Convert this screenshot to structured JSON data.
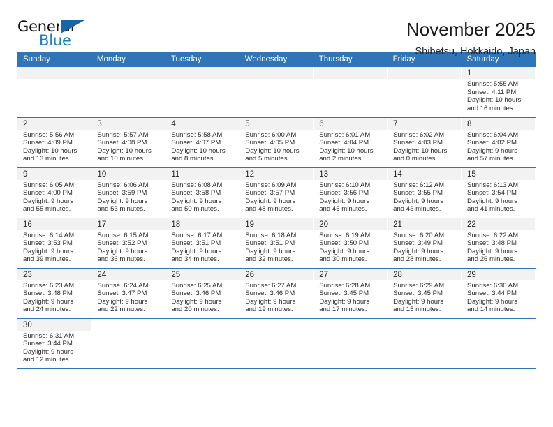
{
  "brand": {
    "name_part1": "General",
    "name_part2": "Blue",
    "accent_color": "#1b7fc4",
    "triangle_color": "#1565a8"
  },
  "header": {
    "title": "November 2025",
    "subtitle": "Shibetsu, Hokkaido, Japan",
    "header_bg_color": "#3075b8",
    "daynum_bg_color": "#f2f2f2"
  },
  "weekday_headers": [
    "Sunday",
    "Monday",
    "Tuesday",
    "Wednesday",
    "Thursday",
    "Friday",
    "Saturday"
  ],
  "weeks": [
    [
      {
        "day": "",
        "sunrise": "",
        "sunset": "",
        "daylight_line1": "",
        "daylight_line2": ""
      },
      {
        "day": "",
        "sunrise": "",
        "sunset": "",
        "daylight_line1": "",
        "daylight_line2": ""
      },
      {
        "day": "",
        "sunrise": "",
        "sunset": "",
        "daylight_line1": "",
        "daylight_line2": ""
      },
      {
        "day": "",
        "sunrise": "",
        "sunset": "",
        "daylight_line1": "",
        "daylight_line2": ""
      },
      {
        "day": "",
        "sunrise": "",
        "sunset": "",
        "daylight_line1": "",
        "daylight_line2": ""
      },
      {
        "day": "",
        "sunrise": "",
        "sunset": "",
        "daylight_line1": "",
        "daylight_line2": ""
      },
      {
        "day": "1",
        "sunrise": "Sunrise: 5:55 AM",
        "sunset": "Sunset: 4:11 PM",
        "daylight_line1": "Daylight: 10 hours",
        "daylight_line2": "and 16 minutes."
      }
    ],
    [
      {
        "day": "2",
        "sunrise": "Sunrise: 5:56 AM",
        "sunset": "Sunset: 4:09 PM",
        "daylight_line1": "Daylight: 10 hours",
        "daylight_line2": "and 13 minutes."
      },
      {
        "day": "3",
        "sunrise": "Sunrise: 5:57 AM",
        "sunset": "Sunset: 4:08 PM",
        "daylight_line1": "Daylight: 10 hours",
        "daylight_line2": "and 10 minutes."
      },
      {
        "day": "4",
        "sunrise": "Sunrise: 5:58 AM",
        "sunset": "Sunset: 4:07 PM",
        "daylight_line1": "Daylight: 10 hours",
        "daylight_line2": "and 8 minutes."
      },
      {
        "day": "5",
        "sunrise": "Sunrise: 6:00 AM",
        "sunset": "Sunset: 4:05 PM",
        "daylight_line1": "Daylight: 10 hours",
        "daylight_line2": "and 5 minutes."
      },
      {
        "day": "6",
        "sunrise": "Sunrise: 6:01 AM",
        "sunset": "Sunset: 4:04 PM",
        "daylight_line1": "Daylight: 10 hours",
        "daylight_line2": "and 2 minutes."
      },
      {
        "day": "7",
        "sunrise": "Sunrise: 6:02 AM",
        "sunset": "Sunset: 4:03 PM",
        "daylight_line1": "Daylight: 10 hours",
        "daylight_line2": "and 0 minutes."
      },
      {
        "day": "8",
        "sunrise": "Sunrise: 6:04 AM",
        "sunset": "Sunset: 4:02 PM",
        "daylight_line1": "Daylight: 9 hours",
        "daylight_line2": "and 57 minutes."
      }
    ],
    [
      {
        "day": "9",
        "sunrise": "Sunrise: 6:05 AM",
        "sunset": "Sunset: 4:00 PM",
        "daylight_line1": "Daylight: 9 hours",
        "daylight_line2": "and 55 minutes."
      },
      {
        "day": "10",
        "sunrise": "Sunrise: 6:06 AM",
        "sunset": "Sunset: 3:59 PM",
        "daylight_line1": "Daylight: 9 hours",
        "daylight_line2": "and 53 minutes."
      },
      {
        "day": "11",
        "sunrise": "Sunrise: 6:08 AM",
        "sunset": "Sunset: 3:58 PM",
        "daylight_line1": "Daylight: 9 hours",
        "daylight_line2": "and 50 minutes."
      },
      {
        "day": "12",
        "sunrise": "Sunrise: 6:09 AM",
        "sunset": "Sunset: 3:57 PM",
        "daylight_line1": "Daylight: 9 hours",
        "daylight_line2": "and 48 minutes."
      },
      {
        "day": "13",
        "sunrise": "Sunrise: 6:10 AM",
        "sunset": "Sunset: 3:56 PM",
        "daylight_line1": "Daylight: 9 hours",
        "daylight_line2": "and 45 minutes."
      },
      {
        "day": "14",
        "sunrise": "Sunrise: 6:12 AM",
        "sunset": "Sunset: 3:55 PM",
        "daylight_line1": "Daylight: 9 hours",
        "daylight_line2": "and 43 minutes."
      },
      {
        "day": "15",
        "sunrise": "Sunrise: 6:13 AM",
        "sunset": "Sunset: 3:54 PM",
        "daylight_line1": "Daylight: 9 hours",
        "daylight_line2": "and 41 minutes."
      }
    ],
    [
      {
        "day": "16",
        "sunrise": "Sunrise: 6:14 AM",
        "sunset": "Sunset: 3:53 PM",
        "daylight_line1": "Daylight: 9 hours",
        "daylight_line2": "and 39 minutes."
      },
      {
        "day": "17",
        "sunrise": "Sunrise: 6:15 AM",
        "sunset": "Sunset: 3:52 PM",
        "daylight_line1": "Daylight: 9 hours",
        "daylight_line2": "and 36 minutes."
      },
      {
        "day": "18",
        "sunrise": "Sunrise: 6:17 AM",
        "sunset": "Sunset: 3:51 PM",
        "daylight_line1": "Daylight: 9 hours",
        "daylight_line2": "and 34 minutes."
      },
      {
        "day": "19",
        "sunrise": "Sunrise: 6:18 AM",
        "sunset": "Sunset: 3:51 PM",
        "daylight_line1": "Daylight: 9 hours",
        "daylight_line2": "and 32 minutes."
      },
      {
        "day": "20",
        "sunrise": "Sunrise: 6:19 AM",
        "sunset": "Sunset: 3:50 PM",
        "daylight_line1": "Daylight: 9 hours",
        "daylight_line2": "and 30 minutes."
      },
      {
        "day": "21",
        "sunrise": "Sunrise: 6:20 AM",
        "sunset": "Sunset: 3:49 PM",
        "daylight_line1": "Daylight: 9 hours",
        "daylight_line2": "and 28 minutes."
      },
      {
        "day": "22",
        "sunrise": "Sunrise: 6:22 AM",
        "sunset": "Sunset: 3:48 PM",
        "daylight_line1": "Daylight: 9 hours",
        "daylight_line2": "and 26 minutes."
      }
    ],
    [
      {
        "day": "23",
        "sunrise": "Sunrise: 6:23 AM",
        "sunset": "Sunset: 3:48 PM",
        "daylight_line1": "Daylight: 9 hours",
        "daylight_line2": "and 24 minutes."
      },
      {
        "day": "24",
        "sunrise": "Sunrise: 6:24 AM",
        "sunset": "Sunset: 3:47 PM",
        "daylight_line1": "Daylight: 9 hours",
        "daylight_line2": "and 22 minutes."
      },
      {
        "day": "25",
        "sunrise": "Sunrise: 6:25 AM",
        "sunset": "Sunset: 3:46 PM",
        "daylight_line1": "Daylight: 9 hours",
        "daylight_line2": "and 20 minutes."
      },
      {
        "day": "26",
        "sunrise": "Sunrise: 6:27 AM",
        "sunset": "Sunset: 3:46 PM",
        "daylight_line1": "Daylight: 9 hours",
        "daylight_line2": "and 19 minutes."
      },
      {
        "day": "27",
        "sunrise": "Sunrise: 6:28 AM",
        "sunset": "Sunset: 3:45 PM",
        "daylight_line1": "Daylight: 9 hours",
        "daylight_line2": "and 17 minutes."
      },
      {
        "day": "28",
        "sunrise": "Sunrise: 6:29 AM",
        "sunset": "Sunset: 3:45 PM",
        "daylight_line1": "Daylight: 9 hours",
        "daylight_line2": "and 15 minutes."
      },
      {
        "day": "29",
        "sunrise": "Sunrise: 6:30 AM",
        "sunset": "Sunset: 3:44 PM",
        "daylight_line1": "Daylight: 9 hours",
        "daylight_line2": "and 14 minutes."
      }
    ],
    [
      {
        "day": "30",
        "sunrise": "Sunrise: 6:31 AM",
        "sunset": "Sunset: 3:44 PM",
        "daylight_line1": "Daylight: 9 hours",
        "daylight_line2": "and 12 minutes."
      },
      {
        "day": "",
        "sunrise": "",
        "sunset": "",
        "daylight_line1": "",
        "daylight_line2": ""
      },
      {
        "day": "",
        "sunrise": "",
        "sunset": "",
        "daylight_line1": "",
        "daylight_line2": ""
      },
      {
        "day": "",
        "sunrise": "",
        "sunset": "",
        "daylight_line1": "",
        "daylight_line2": ""
      },
      {
        "day": "",
        "sunrise": "",
        "sunset": "",
        "daylight_line1": "",
        "daylight_line2": ""
      },
      {
        "day": "",
        "sunrise": "",
        "sunset": "",
        "daylight_line1": "",
        "daylight_line2": ""
      },
      {
        "day": "",
        "sunrise": "",
        "sunset": "",
        "daylight_line1": "",
        "daylight_line2": ""
      }
    ]
  ]
}
